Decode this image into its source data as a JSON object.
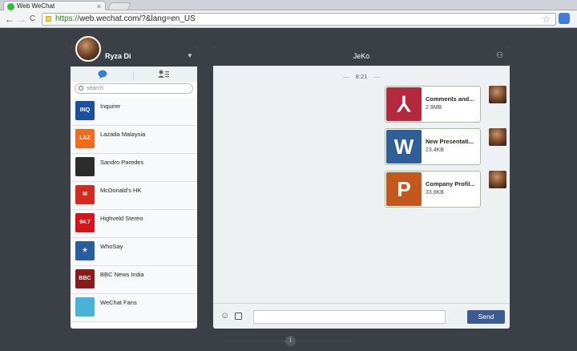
{
  "browser": {
    "tab_title": "Web WeChat",
    "tab_close": "×",
    "back": "←",
    "forward": "→",
    "reload": "C",
    "url_scheme": "https://",
    "url_rest": "web.wechat.com/?&lang=en_US",
    "star": "☆"
  },
  "sidebar": {
    "user_name": "Ryza Di",
    "menu_caret": "▼",
    "search_placeholder": "search",
    "contacts": [
      {
        "name": "Inquirer",
        "icon": "INQ",
        "color": "#1c4fa0"
      },
      {
        "name": "Lazada Malaysia",
        "icon": "LAZ",
        "color": "#f26b1d"
      },
      {
        "name": "Sandro Paredes",
        "icon": "",
        "color": "#2c2c2c"
      },
      {
        "name": "McDonald's HK",
        "icon": "M",
        "color": "#d52b1e"
      },
      {
        "name": "Highveld Stereo",
        "icon": "94.7",
        "color": "#d7131a"
      },
      {
        "name": "WhoSay",
        "icon": "★",
        "color": "#2a5d9f"
      },
      {
        "name": "BBC News India",
        "icon": "BBC",
        "color": "#8b1a1a"
      },
      {
        "name": "WeChat Fans",
        "icon": "",
        "color": "#47b3d9"
      }
    ]
  },
  "chat": {
    "title": "JeKo",
    "group_icon": "⚇",
    "time_divider": "8:21",
    "messages": [
      {
        "file_name": "Comments and...",
        "size": "2.9MB",
        "icon": "⅄",
        "color": "#b5293f"
      },
      {
        "file_name": "New Presentati...",
        "size": "23.4KB",
        "icon": "W",
        "color": "#2f5f96"
      },
      {
        "file_name": "Company Profil...",
        "size": "33.8KB",
        "icon": "P",
        "color": "#c4581c"
      }
    ],
    "emoji_icon": "☺",
    "send_label": "Send"
  },
  "footer": {
    "info_icon": "i"
  }
}
